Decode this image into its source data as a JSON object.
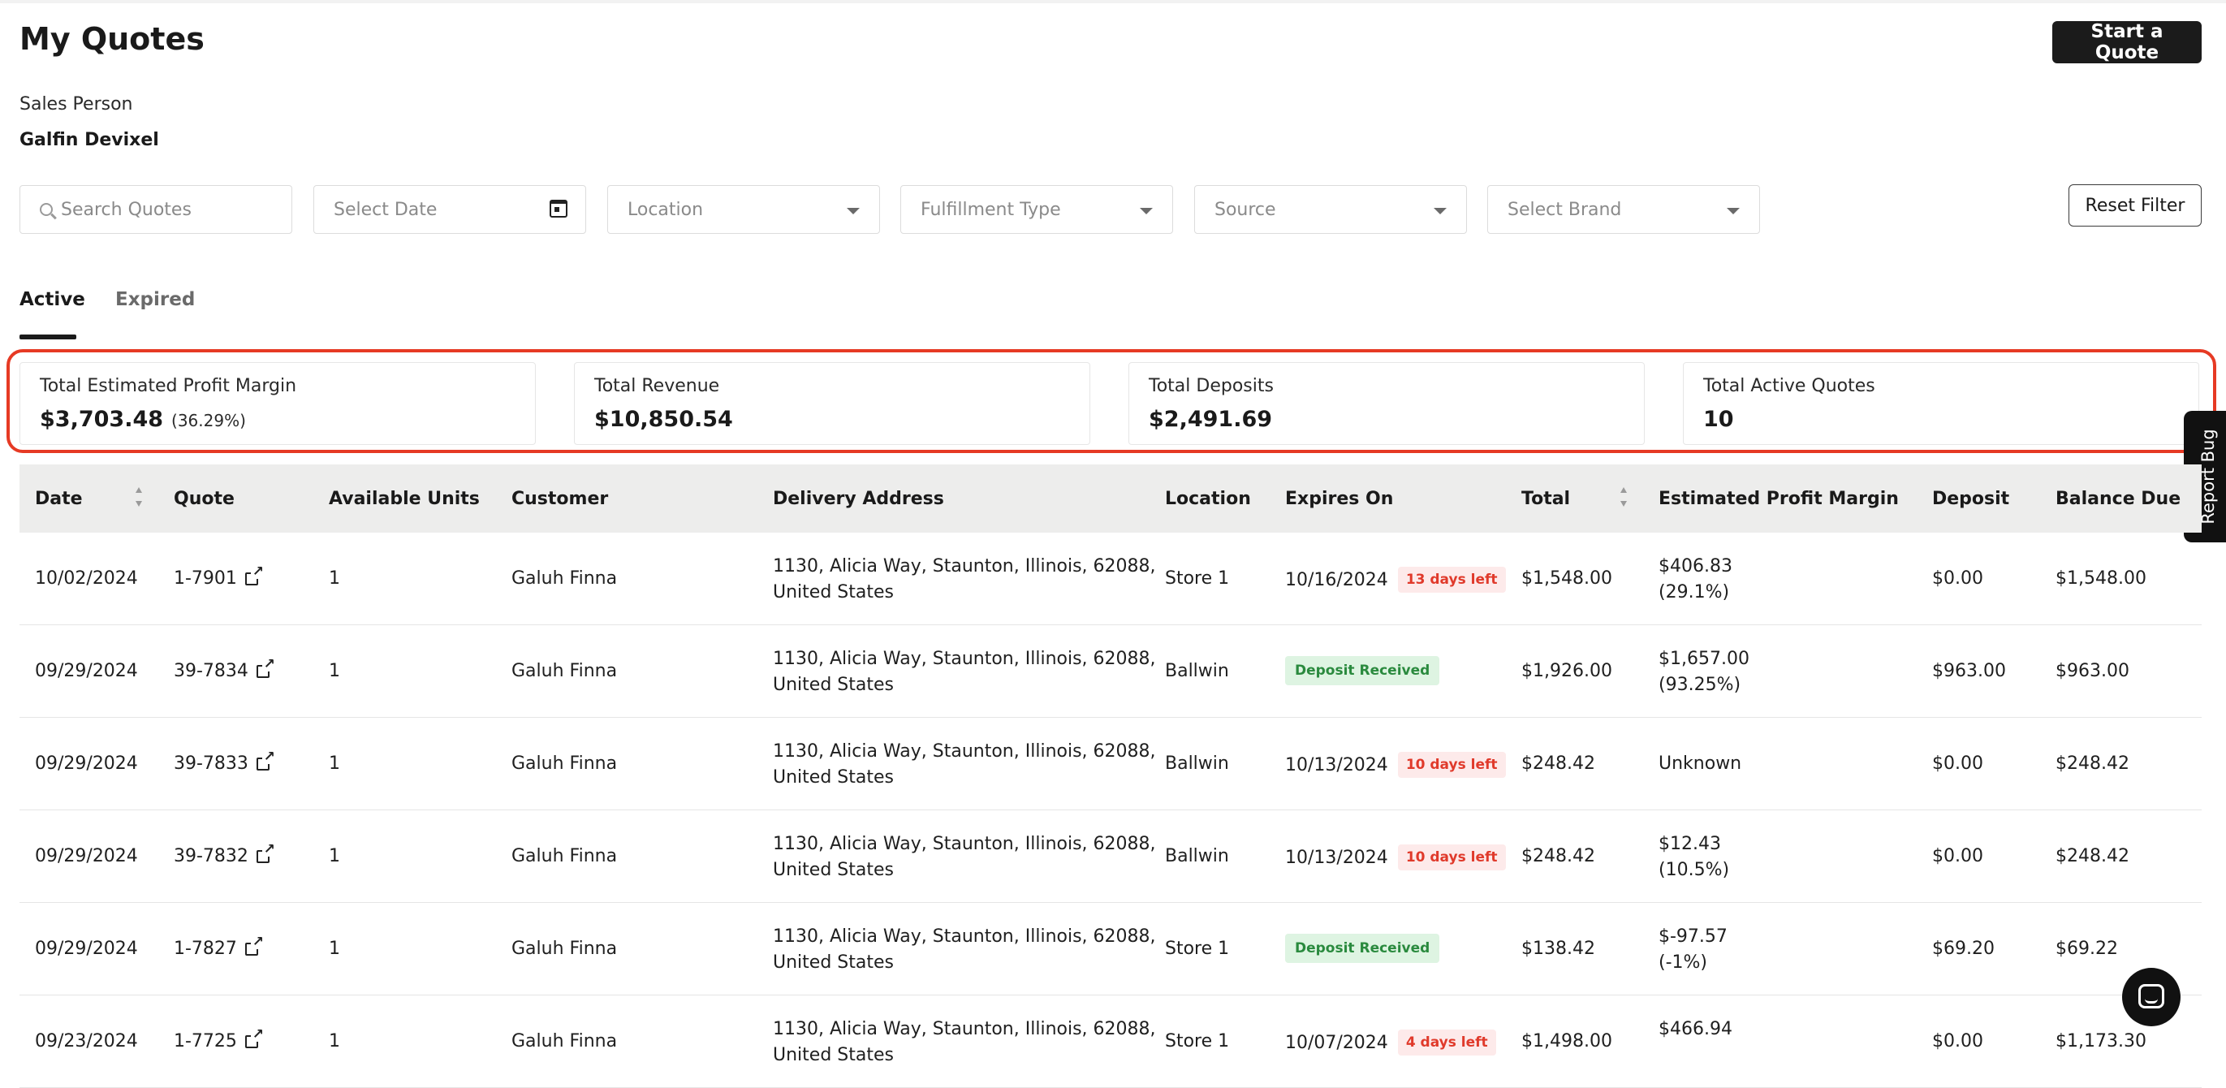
{
  "header": {
    "title": "My Quotes",
    "start_button": "Start a Quote"
  },
  "sales_person": {
    "label": "Sales Person",
    "name": "Galfin Devixel"
  },
  "filters": {
    "search_placeholder": "Search Quotes",
    "date_placeholder": "Select Date",
    "location": "Location",
    "fulfillment": "Fulfillment Type",
    "source": "Source",
    "brand": "Select Brand",
    "reset": "Reset Filter"
  },
  "tabs": {
    "active": "Active",
    "expired": "Expired"
  },
  "summary": {
    "profit": {
      "label": "Total Estimated Profit Margin",
      "value": "$3,703.48",
      "pct": "(36.29%)"
    },
    "revenue": {
      "label": "Total Revenue",
      "value": "$10,850.54"
    },
    "deposits": {
      "label": "Total Deposits",
      "value": "$2,491.69"
    },
    "active": {
      "label": "Total Active Quotes",
      "value": "10"
    }
  },
  "report_bug": "Report Bug",
  "table": {
    "headers": [
      "Date",
      "Quote",
      "Available Units",
      "Customer",
      "Delivery Address",
      "Location",
      "Expires On",
      "Total",
      "Estimated Profit Margin",
      "Deposit",
      "Balance Due"
    ],
    "rows": [
      {
        "date": "10/02/2024",
        "quote": "1-7901",
        "units": "1",
        "customer": "Galuh Finna",
        "addr1": "1130, Alicia Way, Staunton, Illinois, 62088,",
        "addr2": "United States",
        "location": "Store 1",
        "expires": "10/16/2024",
        "badge": "13 days left",
        "total": "$1,548.00",
        "margin1": "$406.83",
        "margin2": "(29.1%)",
        "deposit": "$0.00",
        "balance": "$1,548.00"
      },
      {
        "date": "09/29/2024",
        "quote": "39-7834",
        "units": "1",
        "customer": "Galuh Finna",
        "addr1": "1130, Alicia Way, Staunton, Illinois, 62088,",
        "addr2": "United States",
        "location": "Ballwin",
        "expires": "",
        "badge": "Deposit Received",
        "total": "$1,926.00",
        "margin1": "$1,657.00",
        "margin2": "(93.25%)",
        "deposit": "$963.00",
        "balance": "$963.00"
      },
      {
        "date": "09/29/2024",
        "quote": "39-7833",
        "units": "1",
        "customer": "Galuh Finna",
        "addr1": "1130, Alicia Way, Staunton, Illinois, 62088,",
        "addr2": "United States",
        "location": "Ballwin",
        "expires": "10/13/2024",
        "badge": "10 days left",
        "total": "$248.42",
        "margin1": "Unknown",
        "margin2": "",
        "deposit": "$0.00",
        "balance": "$248.42"
      },
      {
        "date": "09/29/2024",
        "quote": "39-7832",
        "units": "1",
        "customer": "Galuh Finna",
        "addr1": "1130, Alicia Way, Staunton, Illinois, 62088,",
        "addr2": "United States",
        "location": "Ballwin",
        "expires": "10/13/2024",
        "badge": "10 days left",
        "total": "$248.42",
        "margin1": "$12.43",
        "margin2": "(10.5%)",
        "deposit": "$0.00",
        "balance": "$248.42"
      },
      {
        "date": "09/29/2024",
        "quote": "1-7827",
        "units": "1",
        "customer": "Galuh Finna",
        "addr1": "1130, Alicia Way, Staunton, Illinois, 62088,",
        "addr2": "United States",
        "location": "Store 1",
        "expires": "",
        "badge": "Deposit Received",
        "total": "$138.42",
        "margin1": "$-97.57",
        "margin2": "(-1%)",
        "deposit": "$69.20",
        "balance": "$69.22"
      },
      {
        "date": "09/23/2024",
        "quote": "1-7725",
        "units": "1",
        "customer": "Galuh Finna",
        "addr1": "1130, Alicia Way, Staunton, Illinois, 62088,",
        "addr2": "United States",
        "location": "Store 1",
        "expires": "10/07/2024",
        "badge": "4 days left",
        "total": "$1,498.00",
        "margin1": "$466.94",
        "margin2": "",
        "deposit": "$0.00",
        "balance": "$1,173.30"
      }
    ]
  }
}
